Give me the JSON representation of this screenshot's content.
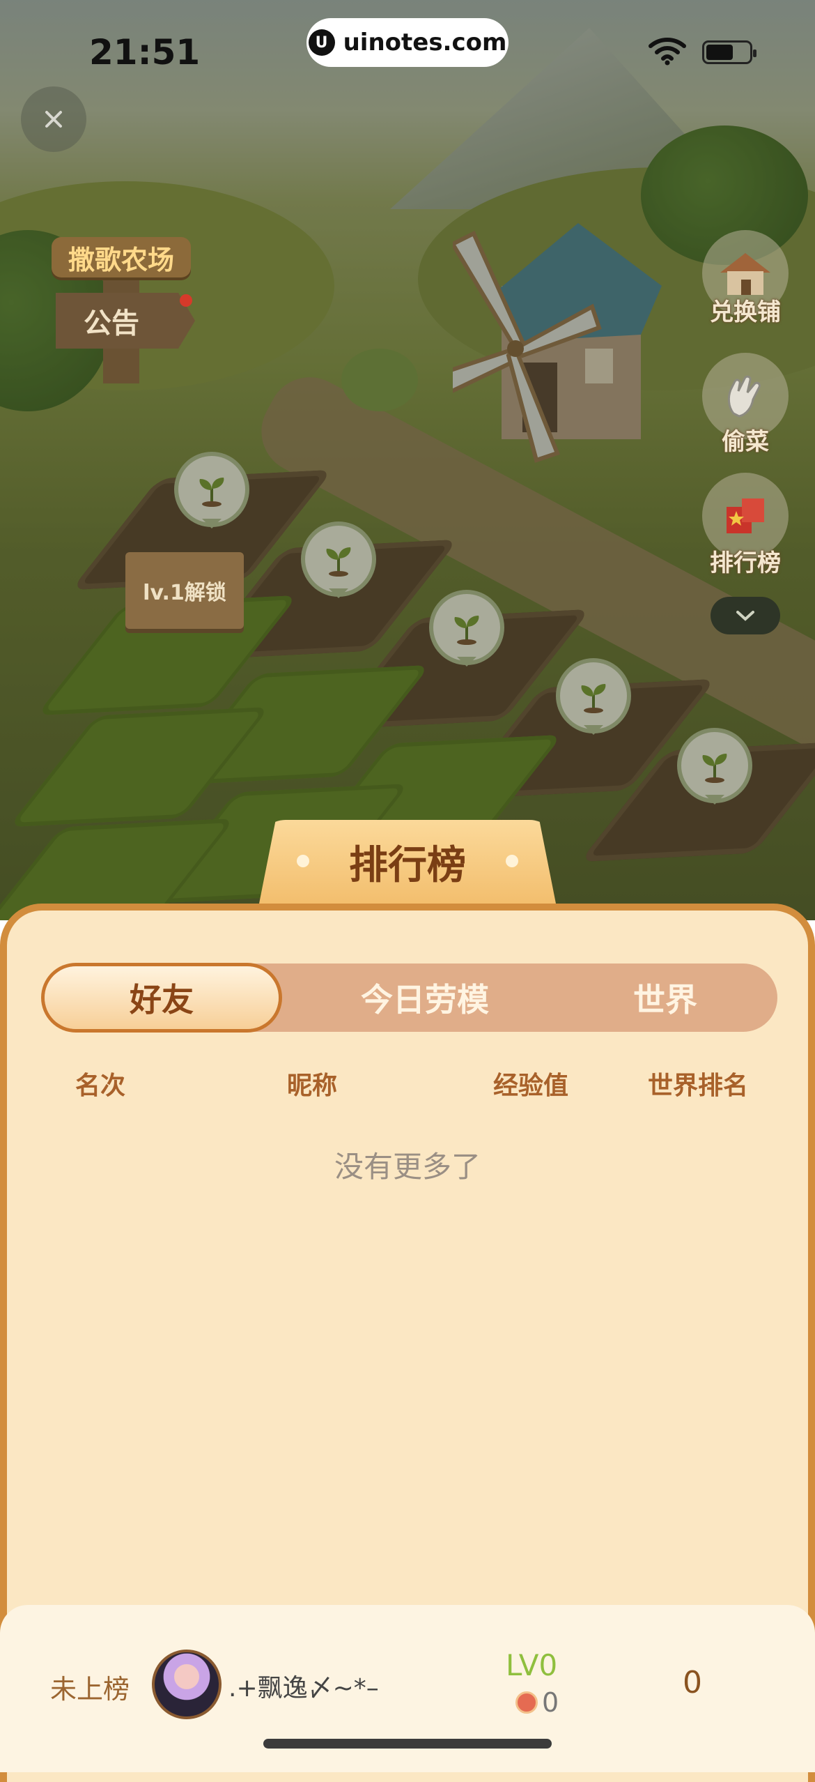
{
  "status_bar": {
    "time": "21:51",
    "url": "uinotes.com"
  },
  "scene": {
    "farm_name": "撒歌农场",
    "notice": "公告",
    "lock_sign": "lv.1解锁",
    "side_buttons": {
      "exchange": "兑换铺",
      "steal": "偷菜",
      "ranking": "排行榜"
    }
  },
  "leaderboard": {
    "title": "排行榜",
    "tabs": [
      "好友",
      "今日劳模",
      "世界"
    ],
    "active_tab": "好友",
    "columns": {
      "rank": "名次",
      "nickname": "昵称",
      "exp": "经验值",
      "world_rank": "世界排名"
    },
    "empty_text": "没有更多了"
  },
  "me": {
    "rank": "未上榜",
    "nickname": ".+飘逸〆~*–",
    "level": "LV0",
    "coins": "0",
    "exp": "0"
  }
}
